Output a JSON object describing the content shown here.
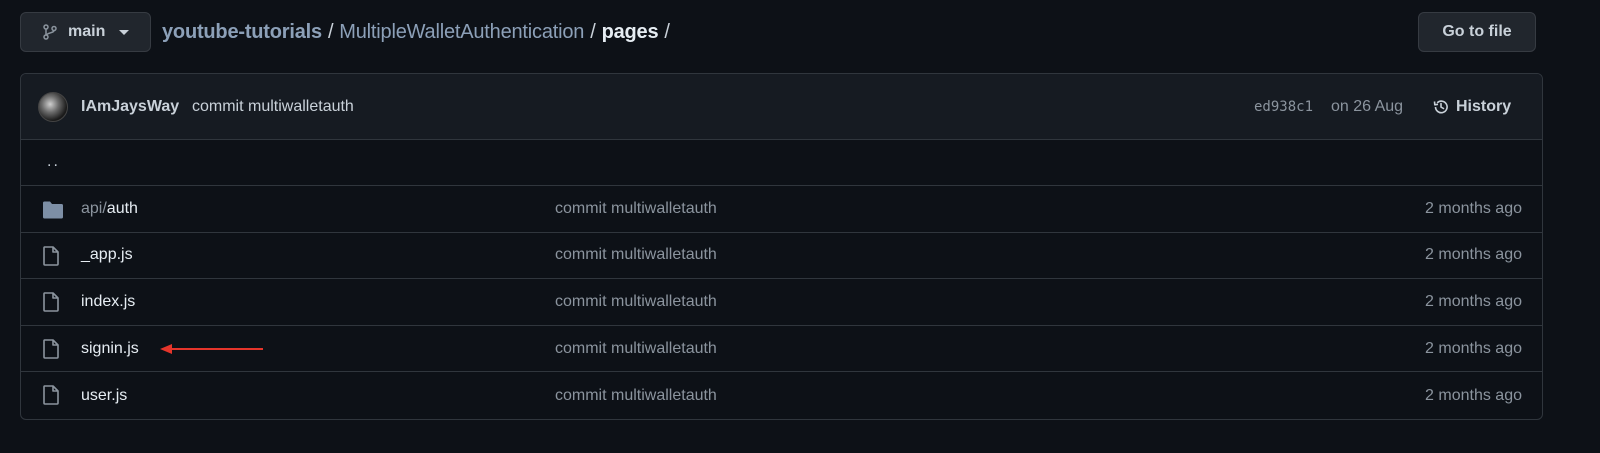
{
  "branch": {
    "label": "main",
    "icon": "git-branch-icon"
  },
  "breadcrumb": {
    "repo": "youtube-tutorials",
    "sep": "/",
    "dir": "MultipleWalletAuthentication",
    "current": "pages",
    "trailing_sep": "/"
  },
  "goto_file": "Go to file",
  "commit": {
    "author": "IAmJaysWay",
    "message": "commit multiwalletauth",
    "hash": "ed938c1",
    "date": "on 26 Aug",
    "history_label": "History"
  },
  "parent_dir": "..",
  "files": [
    {
      "type": "folder",
      "prefix": "api/",
      "name": "auth",
      "message": "commit multiwalletauth",
      "age": "2 months ago"
    },
    {
      "type": "file",
      "prefix": "",
      "name": "_app.js",
      "message": "commit multiwalletauth",
      "age": "2 months ago"
    },
    {
      "type": "file",
      "prefix": "",
      "name": "index.js",
      "message": "commit multiwalletauth",
      "age": "2 months ago"
    },
    {
      "type": "file",
      "prefix": "",
      "name": "signin.js",
      "message": "commit multiwalletauth",
      "age": "2 months ago"
    },
    {
      "type": "file",
      "prefix": "",
      "name": "user.js",
      "message": "commit multiwalletauth",
      "age": "2 months ago"
    }
  ],
  "colors": {
    "background": "#0d1117",
    "annotation_arrow": "#e5352b",
    "folder": "#7d8fa6"
  }
}
